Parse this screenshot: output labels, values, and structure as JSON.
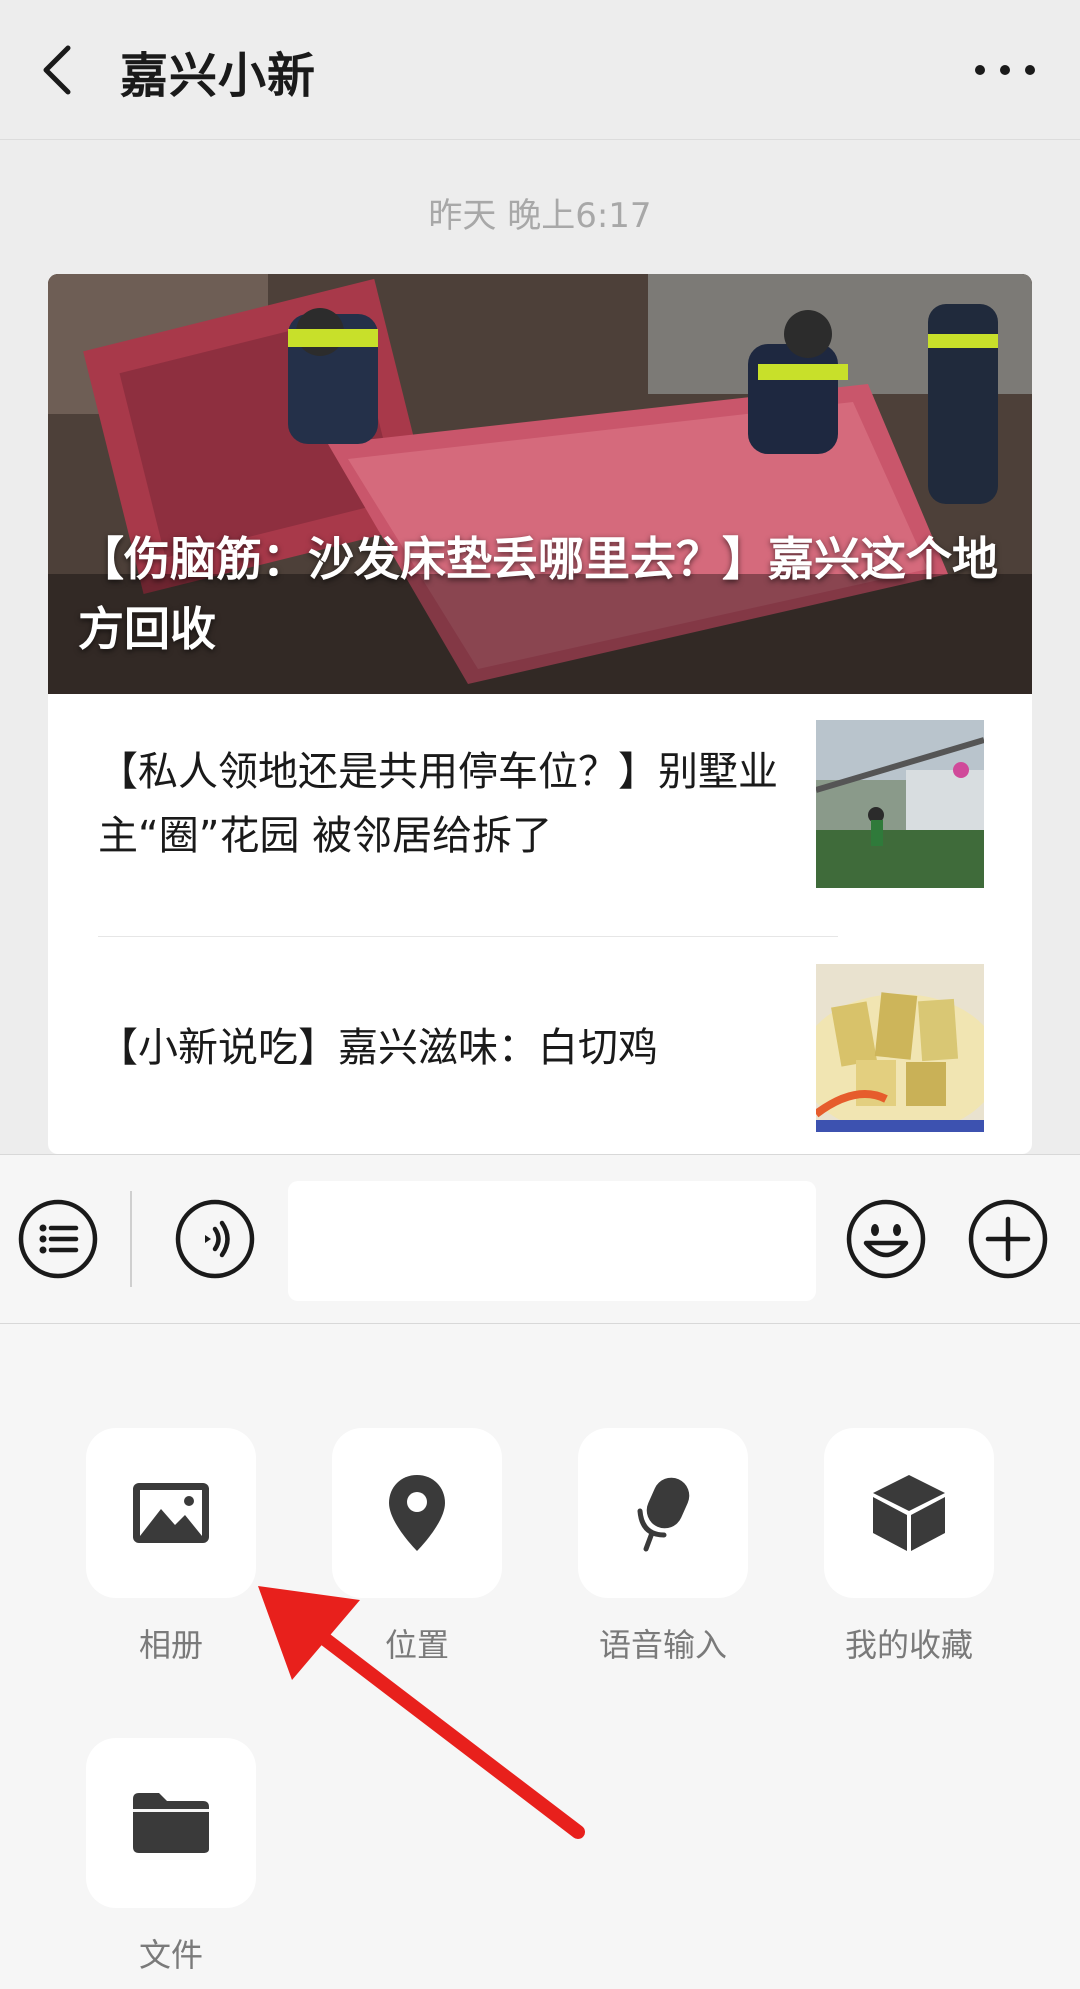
{
  "header": {
    "title": "嘉兴小新",
    "back_icon": "chevron-left-icon",
    "more_icon": "more-horizontal-icon"
  },
  "chat": {
    "timestamp": "昨天 晚上6:17",
    "card": {
      "cover_title": "【伤脑筋：沙发床垫丢哪里去？】嘉兴这个地方回收",
      "items": [
        {
          "title": "【私人领地还是共用停车位？】别墅业主“圈”花园 被邻居给拆了"
        },
        {
          "title": "【小新说吃】嘉兴滋味：白切鸡"
        }
      ]
    }
  },
  "input_bar": {
    "menu_icon": "list-icon",
    "voice_icon": "voice-icon",
    "emoji_icon": "emoji-icon",
    "plus_icon": "plus-icon",
    "text_value": ""
  },
  "tools": [
    {
      "label": "相册",
      "icon": "album-icon"
    },
    {
      "label": "位置",
      "icon": "location-icon"
    },
    {
      "label": "语音输入",
      "icon": "microphone-icon"
    },
    {
      "label": "我的收藏",
      "icon": "favorites-icon"
    },
    {
      "label": "文件",
      "icon": "folder-icon"
    }
  ],
  "colors": {
    "background": "#ededed",
    "panel": "#f6f6f6",
    "annotation_arrow": "#e8201c"
  }
}
